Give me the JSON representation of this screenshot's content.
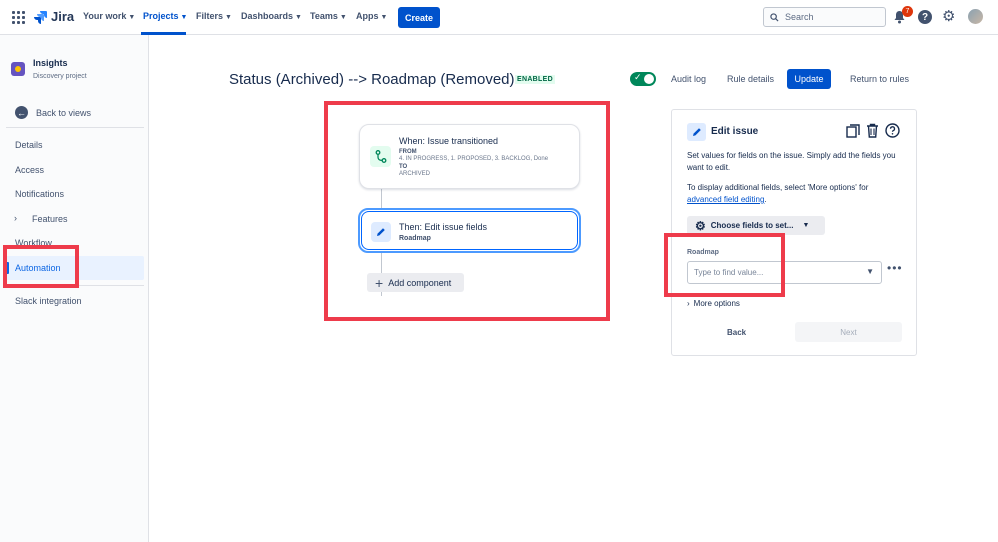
{
  "topnav": {
    "logo": "Jira",
    "items": [
      {
        "label": "Your work"
      },
      {
        "label": "Projects"
      },
      {
        "label": "Filters"
      },
      {
        "label": "Dashboards"
      },
      {
        "label": "Teams"
      },
      {
        "label": "Apps"
      }
    ],
    "create_label": "Create",
    "search_placeholder": "Search",
    "notification_count": "7",
    "help_glyph": "?"
  },
  "sidebar": {
    "project_name": "Insights",
    "project_type": "Discovery project",
    "back_label": "Back to views",
    "items": [
      {
        "label": "Details"
      },
      {
        "label": "Access"
      },
      {
        "label": "Notifications"
      },
      {
        "label": "Features"
      },
      {
        "label": "Workflow"
      },
      {
        "label": "Automation"
      },
      {
        "label": "Slack integration"
      }
    ],
    "active_item": "Automation"
  },
  "rule": {
    "title": "Status (Archived) --> Roadmap (Removed)",
    "status_badge": "ENABLED",
    "enabled": true,
    "audit_log": "Audit log",
    "rule_details": "Rule details",
    "update": "Update",
    "return_to_rules": "Return to rules"
  },
  "flow": {
    "trigger": {
      "title": "When: Issue transitioned",
      "from_label": "FROM",
      "from_value": "4. IN PROGRESS, 1. PROPOSED, 3. BACKLOG, Done",
      "to_label": "TO",
      "to_value": "ARCHIVED"
    },
    "action": {
      "title": "Then: Edit issue fields",
      "subtitle": "Roadmap"
    },
    "add_component": "Add component"
  },
  "panel": {
    "title": "Edit issue",
    "description_1": "Set values for fields on the issue. Simply add the fields you want to edit.",
    "description_2_prefix": "To display additional fields, select 'More options' for ",
    "description_2_link": "advanced field editing",
    "description_2_suffix": ".",
    "choose_fields": "Choose fields to set...",
    "field_label": "Roadmap",
    "field_placeholder": "Type to find value...",
    "more_options": "More options",
    "back": "Back",
    "next": "Next"
  },
  "colors": {
    "accent": "#0052cc",
    "highlight_box": "#ee3b4b",
    "enabled_green": "#00875a"
  }
}
